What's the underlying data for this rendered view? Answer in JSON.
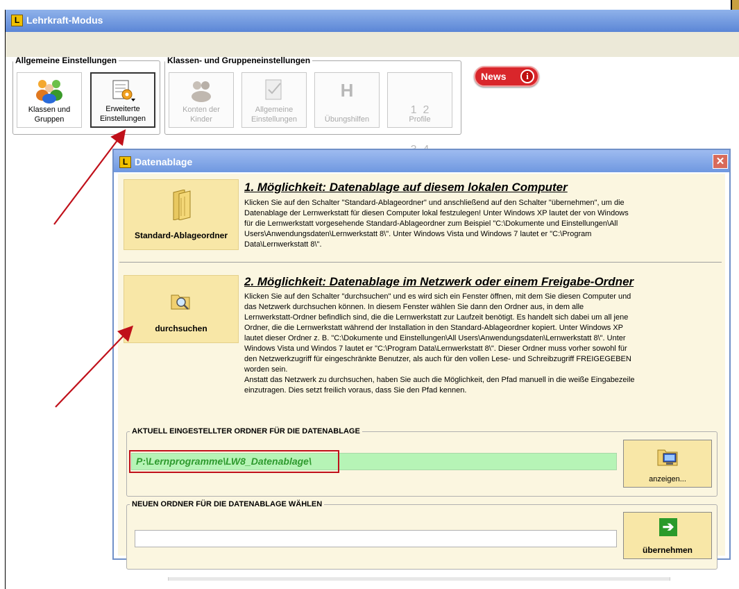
{
  "main_window": {
    "title": "Lehrkraft-Modus",
    "app_icon_glyph": "L"
  },
  "general_settings": {
    "legend": "Allgemeine Einstellungen",
    "buttons": [
      {
        "line1": "Klassen und",
        "line2": "Gruppen",
        "icon": "users-icon",
        "state": "normal"
      },
      {
        "line1": "Erweiterte",
        "line2": "Einstellungen",
        "icon": "notepad-gear-icon",
        "state": "active"
      }
    ]
  },
  "class_settings": {
    "legend": "Klassen- und Gruppeneinstellungen",
    "buttons": [
      {
        "line1": "Konten der",
        "line2": "Kinder",
        "icon": "kids-icon",
        "state": "disabled"
      },
      {
        "line1": "Allgemeine",
        "line2": "Einstellungen",
        "icon": "checklist-icon",
        "state": "disabled"
      },
      {
        "line1": "Übungshilfen",
        "icon_text": "H",
        "icon": "help-h-icon",
        "state": "disabled"
      },
      {
        "line1": "Profile",
        "icon_text_lines": [
          "1  2",
          "3  4"
        ],
        "icon": "profile-numbers-icon",
        "state": "disabled"
      }
    ]
  },
  "news": {
    "label": "News",
    "info_glyph": "i"
  },
  "dialog": {
    "title": "Datenablage",
    "close_glyph": "✕",
    "option1": {
      "button_label": "Standard-Ablageordner",
      "heading": "1. Möglichkeit: Datenablage auf diesem lokalen Computer",
      "lines": [
        "Klicken Sie auf den Schalter \"Standard-Ablageordner\" und anschließend auf den Schalter \"übernehmen\", um die",
        "Datenablage der Lernwerkstatt für diesen Computer lokal festzulegen! Unter Windows XP lautet der von Windows",
        "für die Lernwerkstatt vorgesehende Standard-Ablageordner zum Beispiel \"C:\\Dokumente und Einstellungen\\All",
        "Users\\Anwendungsdaten\\Lernwerkstatt 8\\\". Unter Windows Vista und Windows 7 lautet er \"C:\\Program",
        "Data\\Lernwerkstatt 8\\\"."
      ]
    },
    "option2": {
      "button_label": "durchsuchen",
      "heading": "2. Möglichkeit: Datenablage im Netzwerk oder einem Freigabe-Ordner",
      "lines": [
        "Klicken Sie auf den Schalter \"durchsuchen\" und es wird sich ein Fenster öffnen, mit dem Sie diesen Computer und",
        "das Netzwerk durchsuchen können. In diesem Fenster wählen Sie dann den Ordner aus, in dem alle",
        "Lernwerkstatt-Ordner befindlich sind, die die Lernwerkstatt zur Laufzeit benötigt. Es handelt sich dabei um all jene",
        "Ordner, die die Lernwerkstatt während der Installation in den Standard-Ablageordner kopiert. Unter Windows XP",
        "lautet dieser Ordner z. B. \"C:\\Dokumente und Einstellungen\\All Users\\Anwendungsdaten\\Lernwerkstatt 8\\\". Unter",
        "Windows Vista und Windos 7 lautet er \"C:\\Program Data\\Lernwerkstatt 8\\\". Dieser Ordner muss vorher sowohl für",
        "den Netzwerkzugriff für eingeschränkte Benutzer, als auch für den vollen Lese- und Schreibzugriff FREIGEGEBEN",
        "worden sein.",
        "Anstatt das Netzwerk zu durchsuchen, haben Sie auch die Möglichkeit, den Pfad manuell in die weiße Eingabezeile",
        "einzutragen. Dies setzt freilich voraus, dass Sie den Pfad kennen."
      ]
    },
    "current_folder": {
      "legend": "AKTUELL EINGESTELLTER ORDNER FÜR DIE DATENABLAGE",
      "value": "P:\\Lernprogramme\\LW8_Datenablage\\",
      "button_label": "anzeigen..."
    },
    "new_folder": {
      "legend": "NEUEN ORDNER FÜR DIE DATENABLAGE WÄHLEN",
      "value": "",
      "button_label": "übernehmen"
    }
  },
  "colors": {
    "titlebar": "#6f98e0",
    "dialog_bg": "#fbf6e0",
    "button_bg": "#f8e7a7",
    "path_bg": "#b6f4b6",
    "path_text": "#2e9a2e",
    "annotation_red": "#c0101a",
    "news_red": "#d9262b"
  }
}
